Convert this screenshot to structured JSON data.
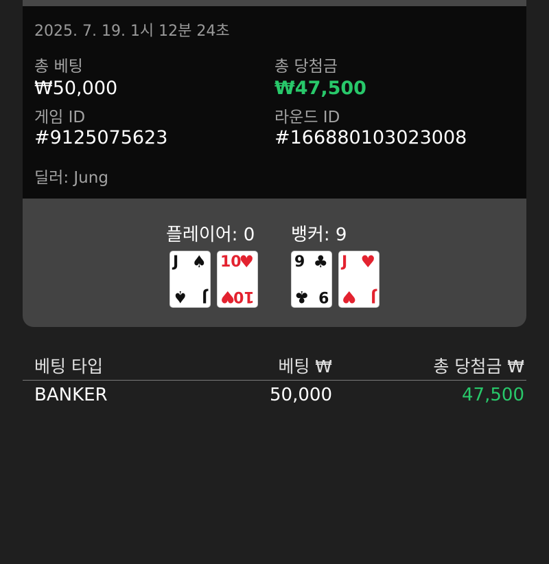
{
  "round": {
    "timestamp": "2025. 7. 19. 1시 12분 24초",
    "total_bet_label": "총 베팅",
    "total_bet_value": "₩50,000",
    "total_win_label": "총 당첨금",
    "total_win_value": "₩47,500",
    "game_id_label": "게임 ID",
    "game_id_value": "#9125075623",
    "round_id_label": "라운드 ID",
    "round_id_value": "#166880103023008",
    "dealer": "딜러: Jung"
  },
  "hands": {
    "player_label": "플레이어: 0",
    "banker_label": "뱅커: 9",
    "player_cards": [
      {
        "rank": "J",
        "suit": "♠",
        "color": "black"
      },
      {
        "rank": "10",
        "suit": "♥",
        "color": "red"
      }
    ],
    "banker_cards": [
      {
        "rank": "9",
        "suit": "♣",
        "color": "black"
      },
      {
        "rank": "J",
        "suit": "♥",
        "color": "red"
      }
    ]
  },
  "bets_table": {
    "headers": [
      "베팅 타입",
      "베팅 ₩",
      "총 당첨금 ₩"
    ],
    "rows": [
      {
        "type": "BANKER",
        "bet": "50,000",
        "win": "47,500"
      }
    ]
  },
  "colors": {
    "win_green": "#28c86a",
    "card_red": "#e3222f",
    "panel_dark": "#0b0b0b",
    "panel_gray": "#434343"
  }
}
